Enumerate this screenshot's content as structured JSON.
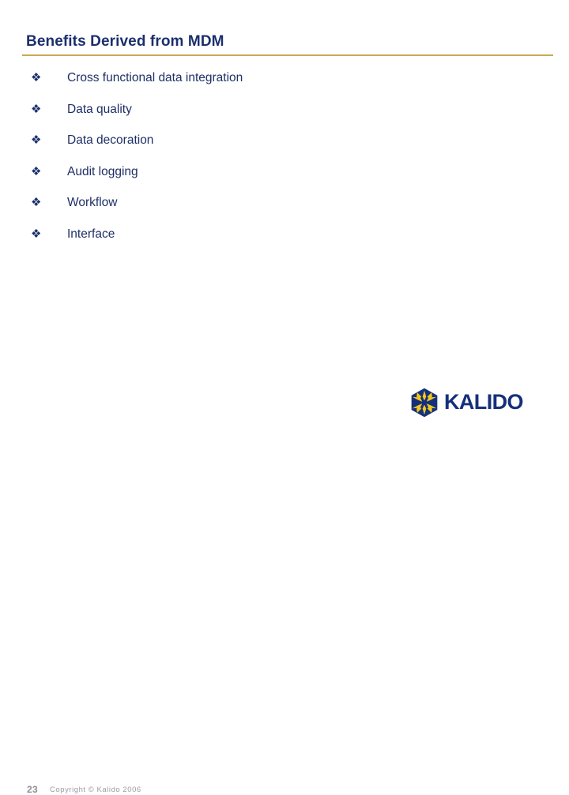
{
  "slide": {
    "title": "Benefits Derived from MDM",
    "rule_color": "#c8a951",
    "title_color": "#1b2f6e",
    "background_color": "#ffffff"
  },
  "bullets": {
    "marker_glyph": "❖",
    "text_color": "#1f2f66",
    "items": [
      {
        "label": "Cross functional data integration"
      },
      {
        "label": "Data quality"
      },
      {
        "label": "Data decoration"
      },
      {
        "label": "Audit logging"
      },
      {
        "label": "Workflow"
      },
      {
        "label": "Interface"
      }
    ]
  },
  "footer": {
    "page_number": "23",
    "copyright": "Copyright © Kalido 2006",
    "page_number_color": "#8d8d97",
    "copyright_color": "#9b9ba4"
  },
  "logo": {
    "wordmark": "KALIDO",
    "hex_color": "#15307a",
    "star_color": "#f2c71e",
    "wordmark_color": "#15307a"
  }
}
